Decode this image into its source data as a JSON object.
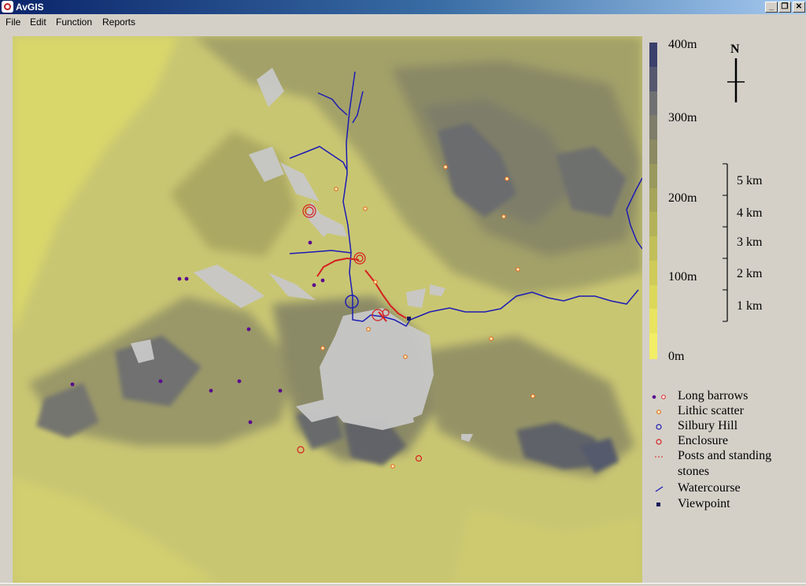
{
  "window": {
    "title": "AvGIS",
    "buttons": {
      "minimize": "_",
      "restore": "❐",
      "close": "✕"
    }
  },
  "menu": [
    {
      "label": "File"
    },
    {
      "label": "Edit"
    },
    {
      "label": "Function"
    },
    {
      "label": "Reports"
    }
  ],
  "elevation_scale": {
    "labels": [
      "400m",
      "300m",
      "200m",
      "100m",
      "0m"
    ],
    "colors": [
      "#3b3f6b",
      "#55586f",
      "#6f7072",
      "#7d7d6a",
      "#8b8a62",
      "#99985d",
      "#a6a45a",
      "#b4b258",
      "#c1bf57",
      "#cecb58",
      "#dbd85a",
      "#e8e45f",
      "#f2ee66"
    ]
  },
  "north_arrow": {
    "label": "N"
  },
  "distance_scale": {
    "labels": [
      "5 km",
      "4 km",
      "3 km",
      "2 km",
      "1 km"
    ]
  },
  "legend": [
    {
      "symbol": "long-barrows",
      "label": "Long barrows"
    },
    {
      "symbol": "lithic-scatter",
      "label": "Lithic scatter"
    },
    {
      "symbol": "silbury-hill",
      "label": "Silbury Hill"
    },
    {
      "symbol": "enclosure",
      "label": "Enclosure"
    },
    {
      "symbol": "posts",
      "label": "Posts and standing stones"
    },
    {
      "symbol": "watercourse",
      "label": "Watercourse"
    },
    {
      "symbol": "viewpoint",
      "label": "Viewpoint"
    }
  ],
  "colors": {
    "watercourse": "#1c1cb4",
    "site_red": "#d42020",
    "barrow_purple": "#5a0a8c",
    "viewshed": "#c8c8c8"
  }
}
